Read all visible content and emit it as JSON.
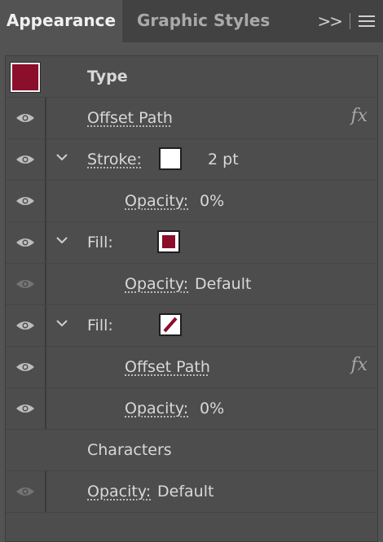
{
  "tabs": {
    "appearance": "Appearance",
    "graphic_styles": "Graphic Styles"
  },
  "header": {
    "title": "Type",
    "swatch_color": "#8b0e2b"
  },
  "rows": [
    {
      "label": "Offset Path",
      "fx": "fx"
    },
    {
      "label": "Stroke:",
      "value": "2 pt",
      "swatch_color": "#ffffff"
    },
    {
      "label": "Opacity:",
      "value": "0%"
    },
    {
      "label": "Fill:",
      "swatch_color": "#8b0e2b"
    },
    {
      "label": "Opacity:",
      "value": "Default"
    },
    {
      "label": "Fill:",
      "swatch_color": "gradient-stripe"
    },
    {
      "label": "Offset Path",
      "fx": "fx"
    },
    {
      "label": "Opacity:",
      "value": "0%"
    },
    {
      "label": "Characters"
    },
    {
      "label": "Opacity:",
      "value": "Default"
    }
  ]
}
